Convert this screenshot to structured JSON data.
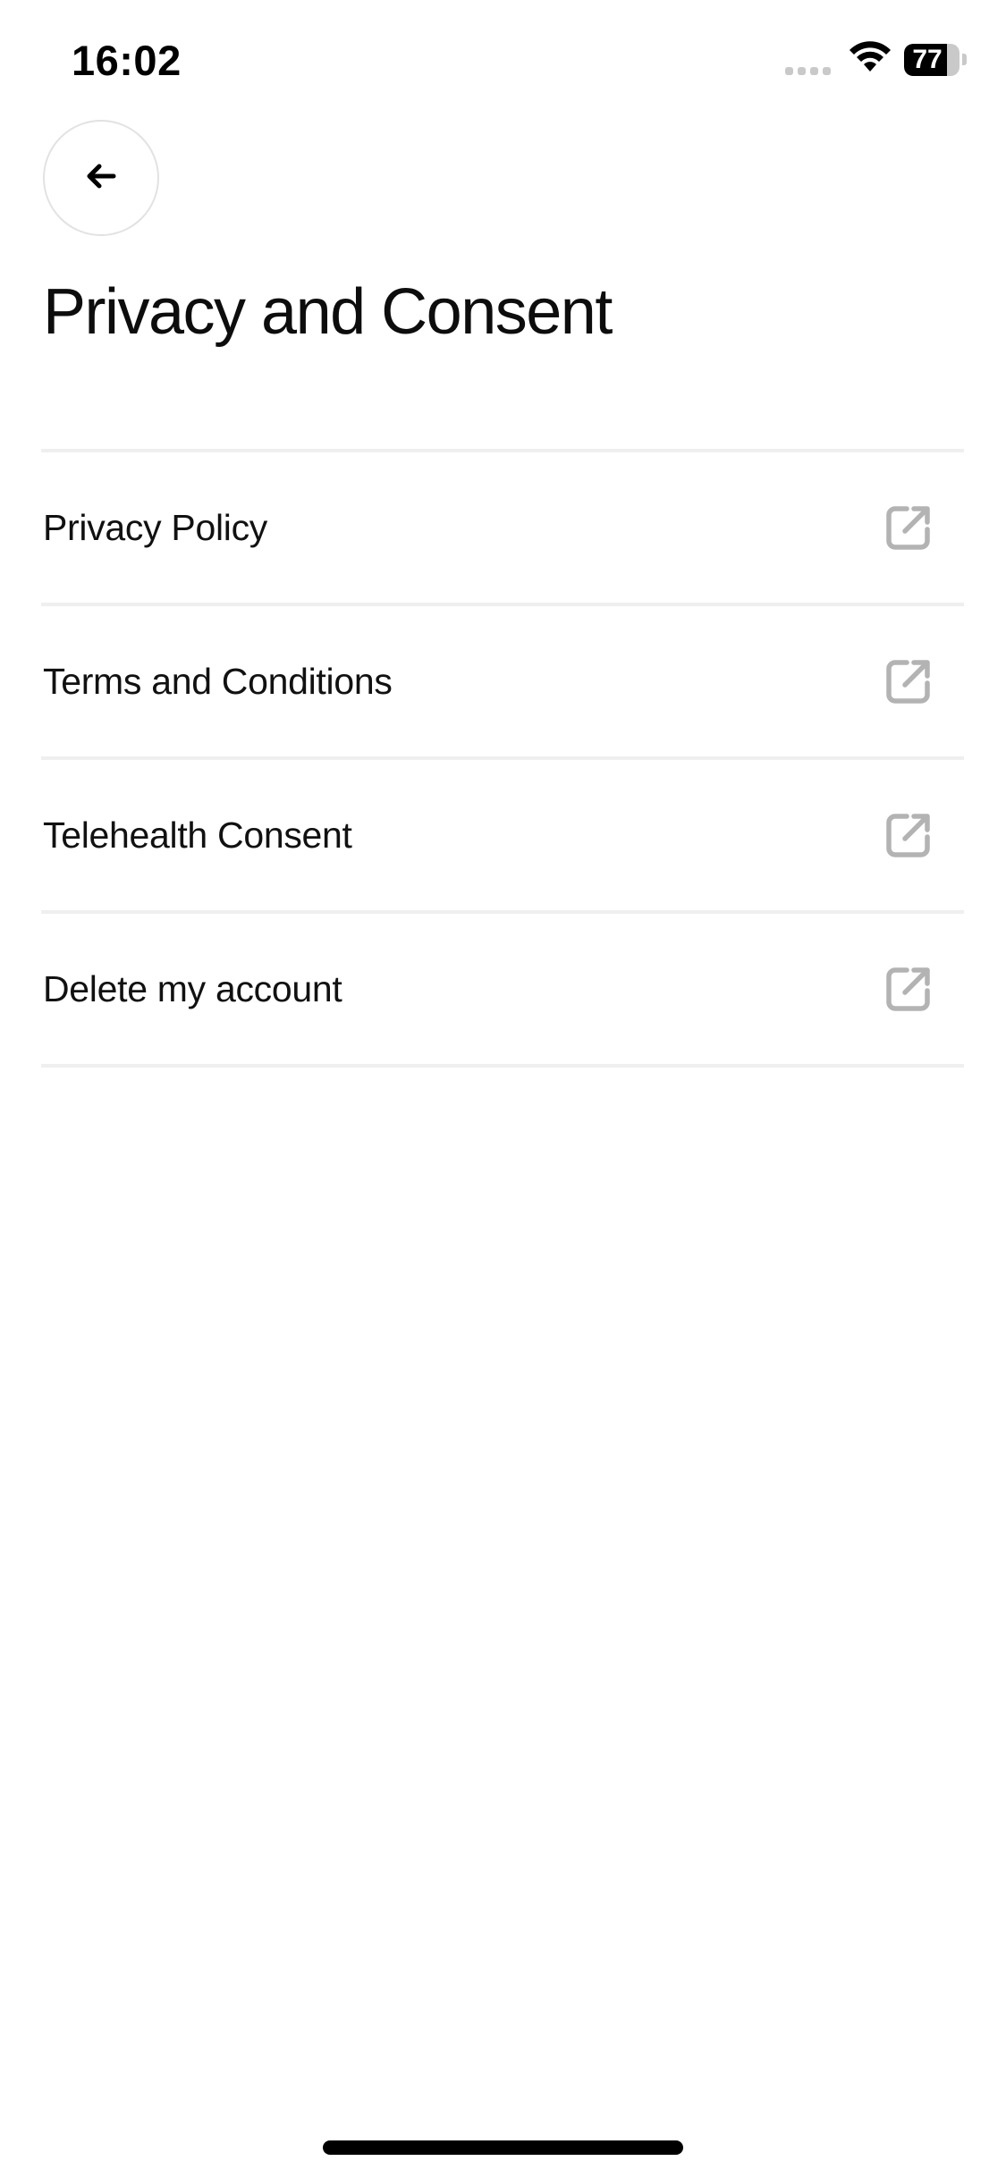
{
  "status_bar": {
    "time": "16:02",
    "battery_level": "77",
    "battery_fraction": 0.77,
    "icons": [
      "signal-icon",
      "wifi-icon",
      "battery-icon"
    ]
  },
  "header": {
    "back_icon": "arrow-left-icon",
    "title": "Privacy and Consent"
  },
  "menu": {
    "items": [
      {
        "label": "Privacy Policy",
        "icon": "external-link-icon"
      },
      {
        "label": "Terms and Conditions",
        "icon": "external-link-icon"
      },
      {
        "label": "Telehealth Consent",
        "icon": "external-link-icon"
      },
      {
        "label": "Delete my account",
        "icon": "external-link-icon"
      }
    ]
  },
  "colors": {
    "text": "#111111",
    "divider": "#efefef",
    "icon": "#b3b3b3",
    "background": "#ffffff"
  }
}
